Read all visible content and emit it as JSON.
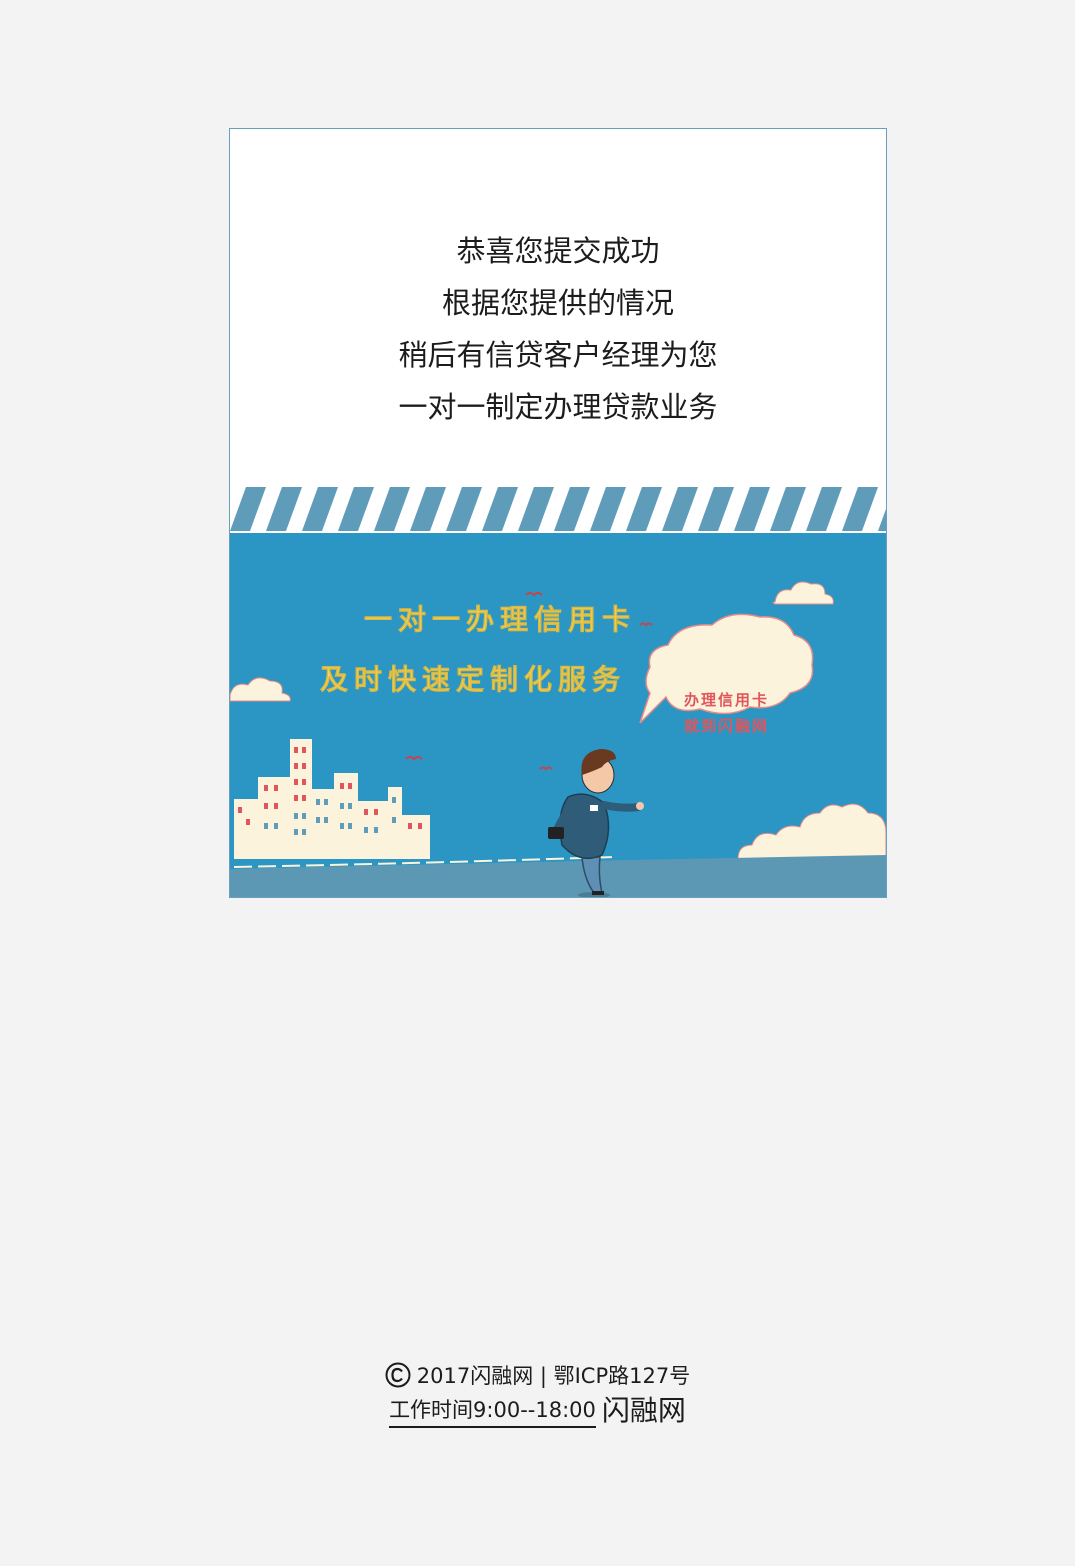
{
  "message": {
    "lines": [
      "恭喜您提交成功",
      "根据您提供的情况",
      "稍后有信贷客户经理为您",
      "一对一制定办理贷款业务"
    ]
  },
  "banner": {
    "headline_1": "一对一办理信用卡",
    "headline_2": "及时快速定制化服务",
    "bubble_line_1": "办理信用卡",
    "bubble_line_2": "就到闪融网"
  },
  "footer": {
    "copyright": "2017闪融网 | 鄂ICP路127号",
    "hours": "工作时间9:00--18:00",
    "brand": "闪融网"
  },
  "colors": {
    "page_bg": "#f3f3f3",
    "sky": "#2b95c4",
    "stripe": "#5f9cba",
    "headline": "#f6d85a",
    "bubble_text": "#e0565c",
    "cloud": "#fbf3dc"
  },
  "icons": [
    "copyright-icon"
  ]
}
